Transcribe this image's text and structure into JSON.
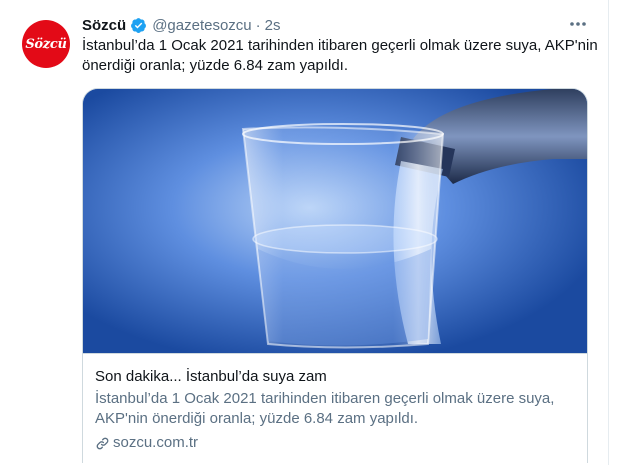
{
  "tweet": {
    "avatar_text": "Sözcü",
    "author_name": "Sözcü",
    "handle": "@gazetesozcu",
    "separator": "·",
    "time": "2s",
    "text": "İstanbul’da 1 Ocak 2021 tarihinden itibaren geçerli olmak üzere suya, AKP'nin önerdiği oranla; yüzde 6.84 zam yapıldı.",
    "verified_icon": "verified-badge-icon",
    "more_icon": "more-dots-icon"
  },
  "card": {
    "title": "Son dakika... İstanbul’da suya zam",
    "description": "İstanbul’da 1 Ocak 2021 tarihinden itibaren geçerli olmak üzere suya, AKP'nin önerdiği oranla; yüzde 6.84 zam yapıldı.",
    "domain": "sozcu.com.tr",
    "link_icon": "link-icon"
  },
  "colors": {
    "brand_red": "#e30a17",
    "verified_blue": "#1da1f2",
    "secondary_text": "#5b7083",
    "border": "#cfd9de"
  }
}
